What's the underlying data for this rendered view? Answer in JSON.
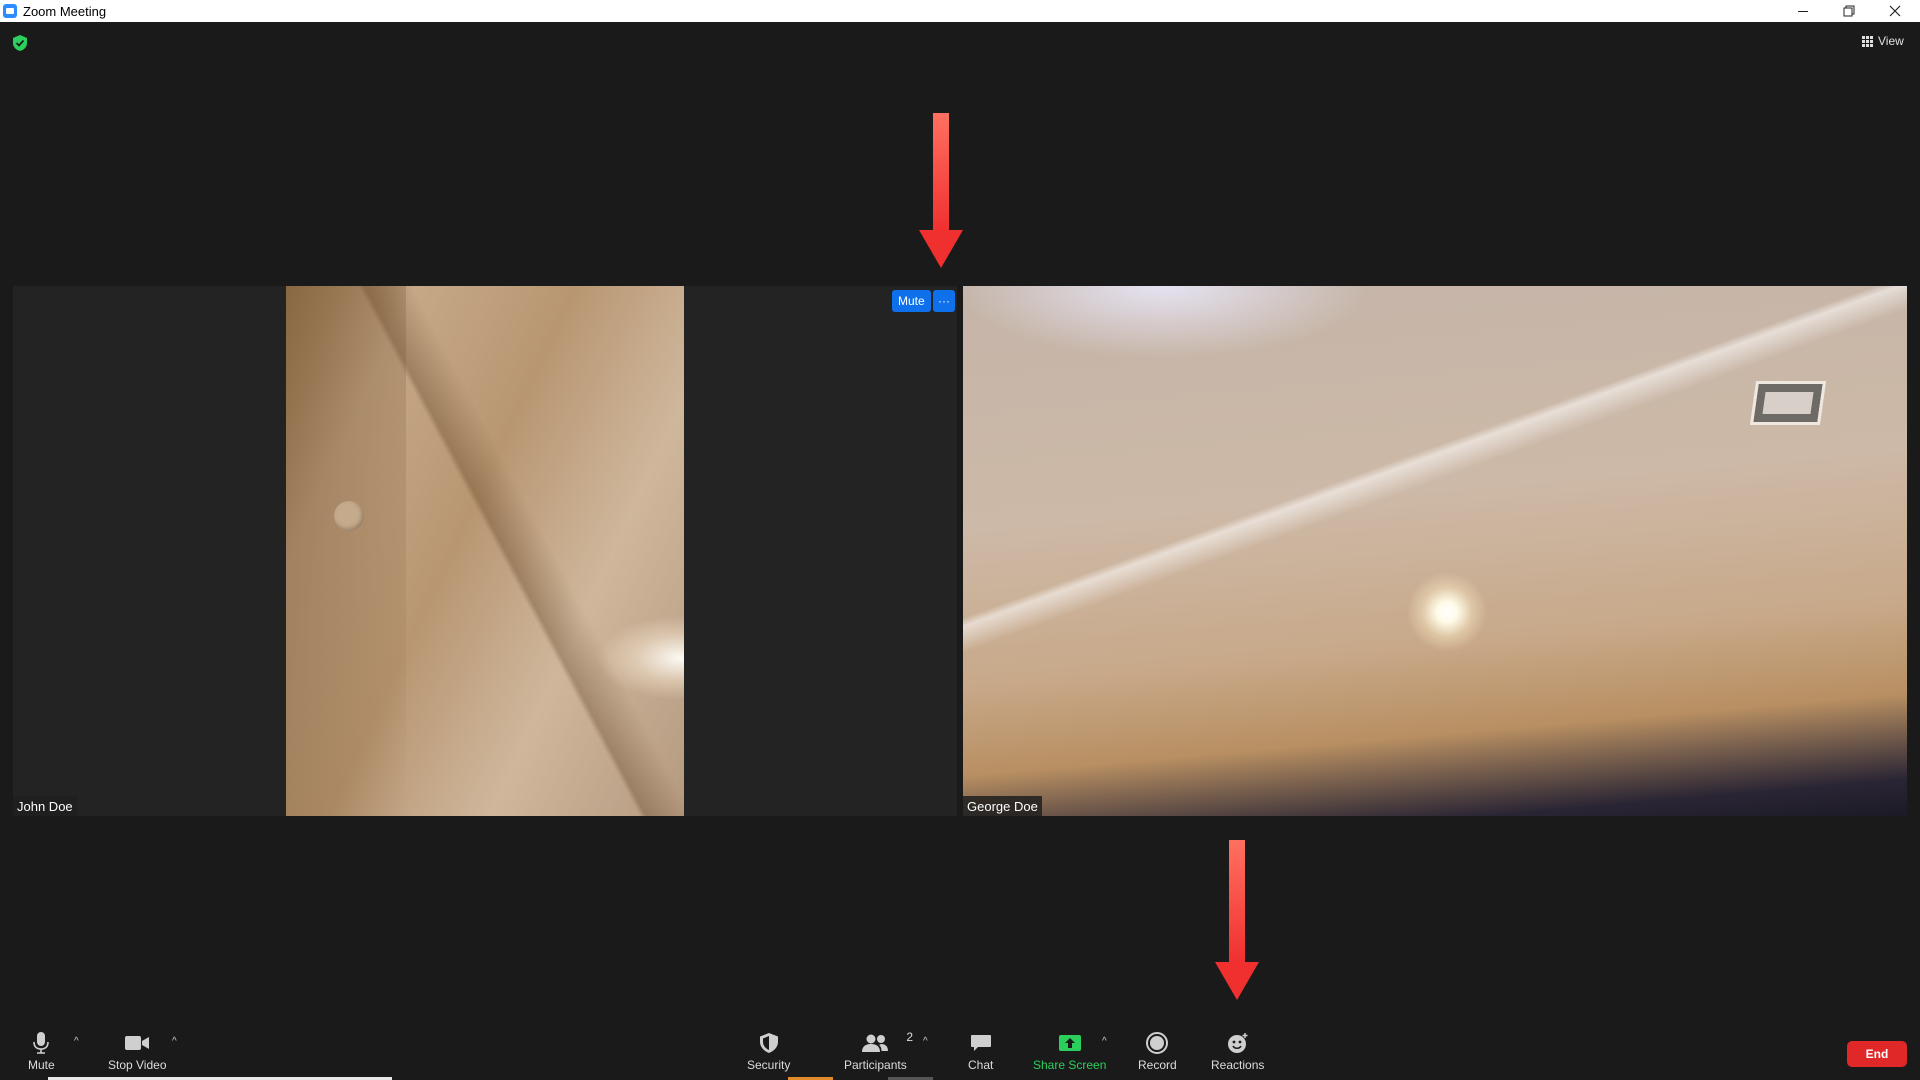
{
  "window": {
    "title": "Zoom Meeting"
  },
  "topbar": {
    "view_label": "View"
  },
  "tiles": {
    "john": {
      "name": "John Doe",
      "mute_label": "Mute",
      "more_label": "···"
    },
    "george": {
      "name": "George Doe"
    }
  },
  "toolbar": {
    "mute_label": "Mute",
    "stop_video_label": "Stop Video",
    "security_label": "Security",
    "participants_label": "Participants",
    "participants_count": "2",
    "chat_label": "Chat",
    "share_screen_label": "Share Screen",
    "record_label": "Record",
    "reactions_label": "Reactions",
    "end_label": "End"
  },
  "colors": {
    "accent_blue": "#0e71eb",
    "share_green": "#2bd05c",
    "end_red": "#e02828",
    "annotation_red": "#f02f2f"
  },
  "icons": [
    "shield-icon",
    "grid-view-icon",
    "microphone-icon",
    "video-camera-icon",
    "security-shield-icon",
    "participants-icon",
    "chat-icon",
    "share-screen-icon",
    "record-icon",
    "reactions-icon"
  ]
}
